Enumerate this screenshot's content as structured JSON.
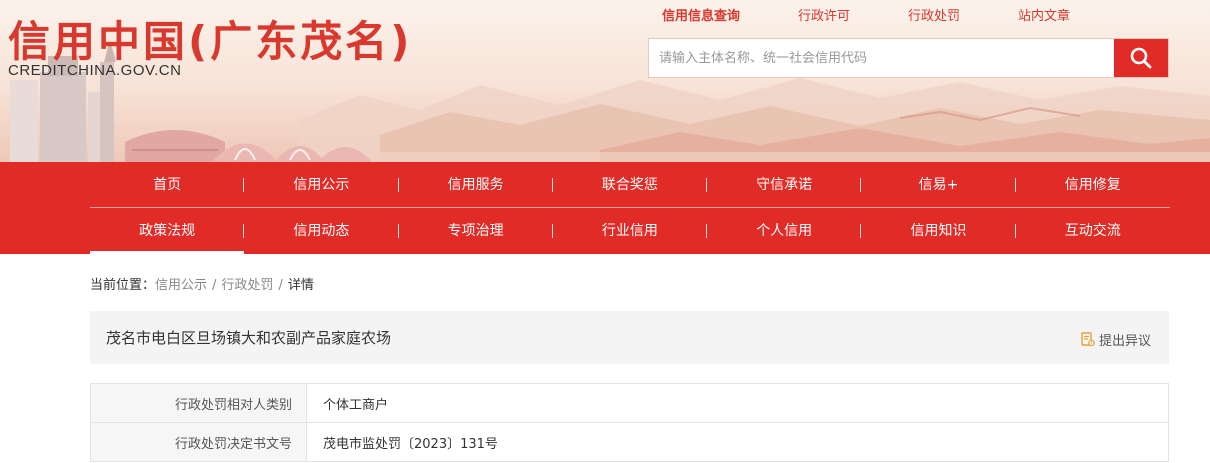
{
  "header": {
    "logo_title": "信用中国(广东茂名)",
    "logo_url": "CREDITCHINA.GOV.CN",
    "top_links": [
      {
        "label": "信用信息查询",
        "active": true
      },
      {
        "label": "行政许可",
        "active": false
      },
      {
        "label": "行政处罚",
        "active": false
      },
      {
        "label": "站内文章",
        "active": false
      }
    ],
    "search": {
      "placeholder": "请输入主体名称、统一社会信用代码",
      "value": "",
      "button_icon": "search-icon"
    }
  },
  "nav": {
    "row1": [
      "首页",
      "信用公示",
      "信用服务",
      "联合奖惩",
      "守信承诺",
      "信易+",
      "信用修复"
    ],
    "row2": [
      "政策法规",
      "信用动态",
      "专项治理",
      "行业信用",
      "个人信用",
      "信用知识",
      "互动交流"
    ]
  },
  "breadcrumb": {
    "prefix": "当前位置：",
    "items": [
      "信用公示",
      "行政处罚",
      "详情"
    ],
    "separator": "/"
  },
  "detail": {
    "entity_name": "茂名市电白区旦场镇大和农副产品家庭农场",
    "objection_label": "提出异议",
    "objection_icon": "objection-document-icon",
    "rows": [
      {
        "label": "行政处罚相对人类别",
        "value": "个体工商户"
      },
      {
        "label": "行政处罚决定书文号",
        "value": "茂电市监处罚〔2023〕131号"
      }
    ]
  },
  "colors": {
    "brand_red": "#e02b27",
    "title_red": "#d9382e"
  }
}
